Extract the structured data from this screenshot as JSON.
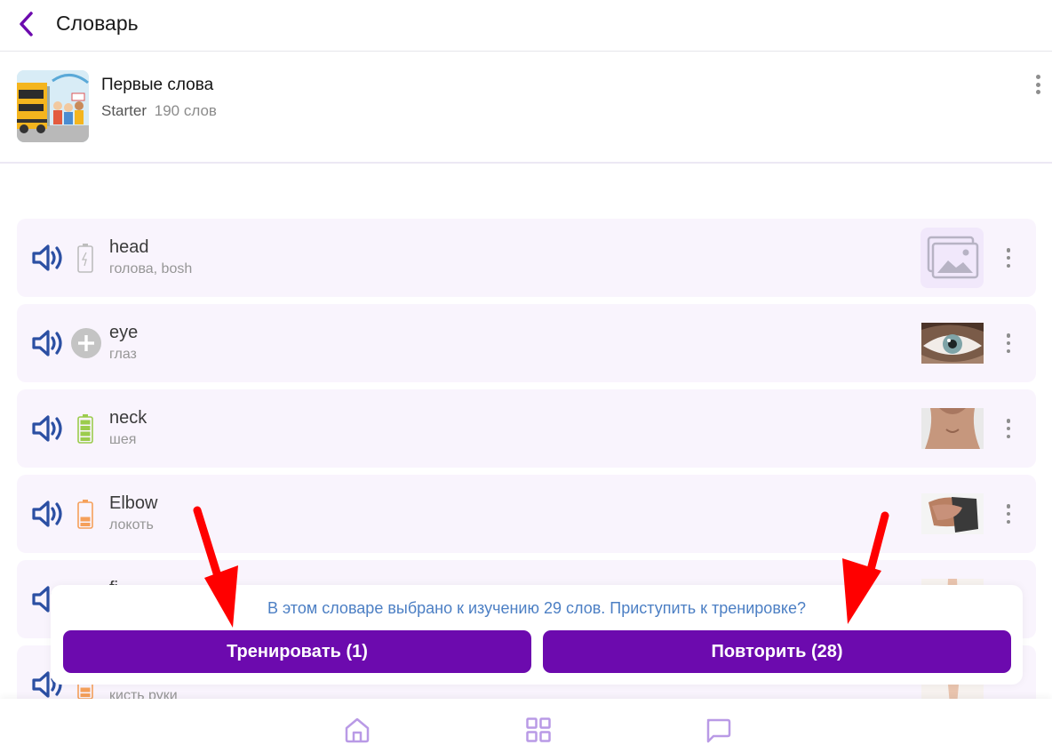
{
  "header": {
    "title": "Словарь"
  },
  "dictionary": {
    "name": "Первые слова",
    "level": "Starter",
    "count": "190 слов"
  },
  "words": [
    {
      "word": "head",
      "translation": "голова, bosh",
      "level_icon": "battery-empty-icon",
      "image": "image-placeholder-icon"
    },
    {
      "word": "eye",
      "translation": "глаз",
      "level_icon": "plus-circle-icon",
      "image": "eye-photo"
    },
    {
      "word": "neck",
      "translation": "шея",
      "level_icon": "battery-green-icon",
      "image": "neck-photo"
    },
    {
      "word": "Elbow",
      "translation": "локоть",
      "level_icon": "battery-orange-icon",
      "image": "elbow-photo"
    },
    {
      "word": "fi",
      "translation": "",
      "level_icon": "",
      "image": "finger-photo"
    },
    {
      "word": "",
      "translation": "кисть руки",
      "level_icon": "battery-orange-icon",
      "image": "hand-photo"
    }
  ],
  "prompt": {
    "text": "В этом словаре выбрано к изучению 29 слов. Приступить к тренировке?",
    "train_label": "Тренировать (1)",
    "repeat_label": "Повторить (28)"
  },
  "nav": {
    "items": [
      "home-icon",
      "grid-icon",
      "chat-icon"
    ]
  },
  "colors": {
    "accent": "#6c0aae",
    "prompt_text": "#4c7fc4",
    "row_bg": "#f9f4fd",
    "annotation_arrow": "#ff0000"
  }
}
